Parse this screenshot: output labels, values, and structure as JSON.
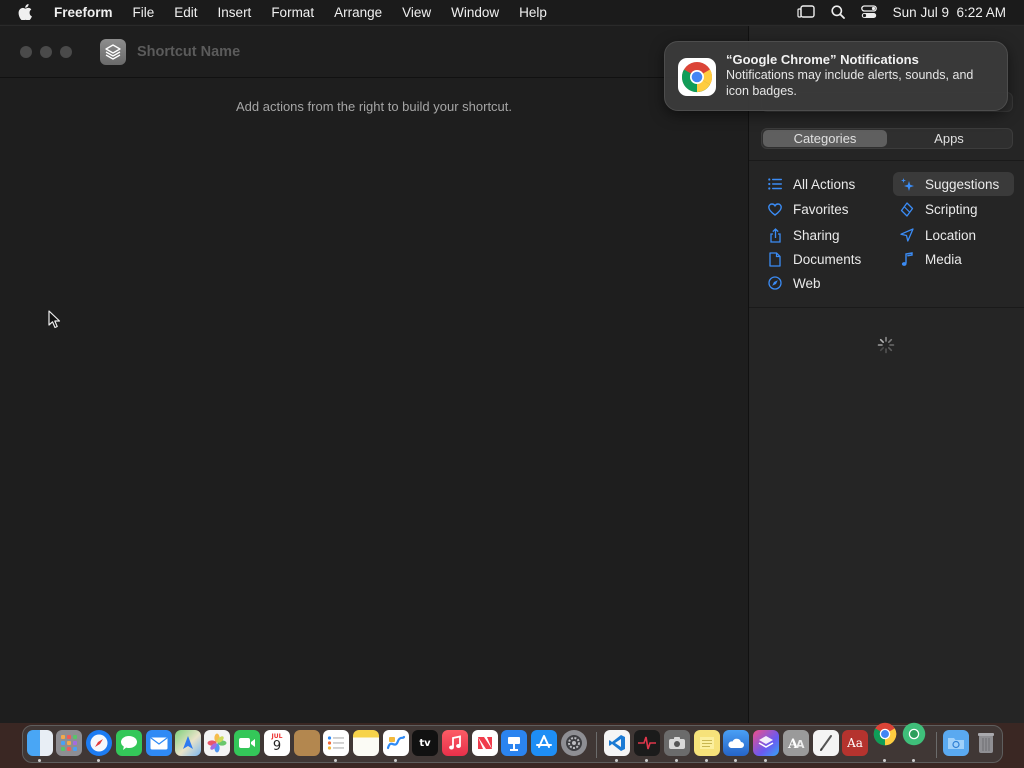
{
  "menubar": {
    "app_name": "Freeform",
    "items": [
      "File",
      "Edit",
      "Insert",
      "Format",
      "Arrange",
      "View",
      "Window",
      "Help"
    ],
    "clock": "Sun Jul 9  6:22 AM"
  },
  "window": {
    "shortcut_name_placeholder": "Shortcut Name",
    "editor_hint": "Add actions from the right to build your shortcut."
  },
  "sidebar": {
    "segments": {
      "categories": "Categories",
      "apps": "Apps",
      "active": "Categories"
    },
    "categories_left": [
      {
        "label": "All Actions",
        "icon": "list-icon"
      },
      {
        "label": "Favorites",
        "icon": "heart-icon"
      },
      {
        "label": "Sharing",
        "icon": "share-icon"
      },
      {
        "label": "Documents",
        "icon": "document-icon"
      },
      {
        "label": "Web",
        "icon": "compass-icon"
      }
    ],
    "categories_right": [
      {
        "label": "Suggestions",
        "icon": "sparkle-icon",
        "selected": true
      },
      {
        "label": "Scripting",
        "icon": "scripting-icon"
      },
      {
        "label": "Location",
        "icon": "location-arrow-icon"
      },
      {
        "label": "Media",
        "icon": "music-note-icon"
      }
    ],
    "accent_color": "#3b8cf5"
  },
  "notification": {
    "title": "“Google Chrome” Notifications",
    "body": "Notifications may include alerts, sounds, and icon badges."
  },
  "dock": {
    "calendar_month": "JUL",
    "calendar_day": "9",
    "appletv_label": "tv",
    "dictionary_label": "Aa",
    "apps": [
      "Finder",
      "Launchpad",
      "Safari",
      "Messages",
      "Mail",
      "Maps",
      "Photos",
      "FaceTime",
      "Calendar",
      "Notes Brown",
      "Reminders",
      "Notes",
      "Freeform",
      "Apple TV",
      "Music",
      "News",
      "Keynote",
      "App Store",
      "System Settings",
      "Visual Studio Code",
      "Instruments",
      "Screenshot",
      "Stickies",
      "Weather",
      "Shortcuts",
      "Font Book",
      "TextEdit",
      "Dictionary",
      "Google Chrome",
      "Chrome Canary",
      "Downloads",
      "Trash"
    ]
  }
}
